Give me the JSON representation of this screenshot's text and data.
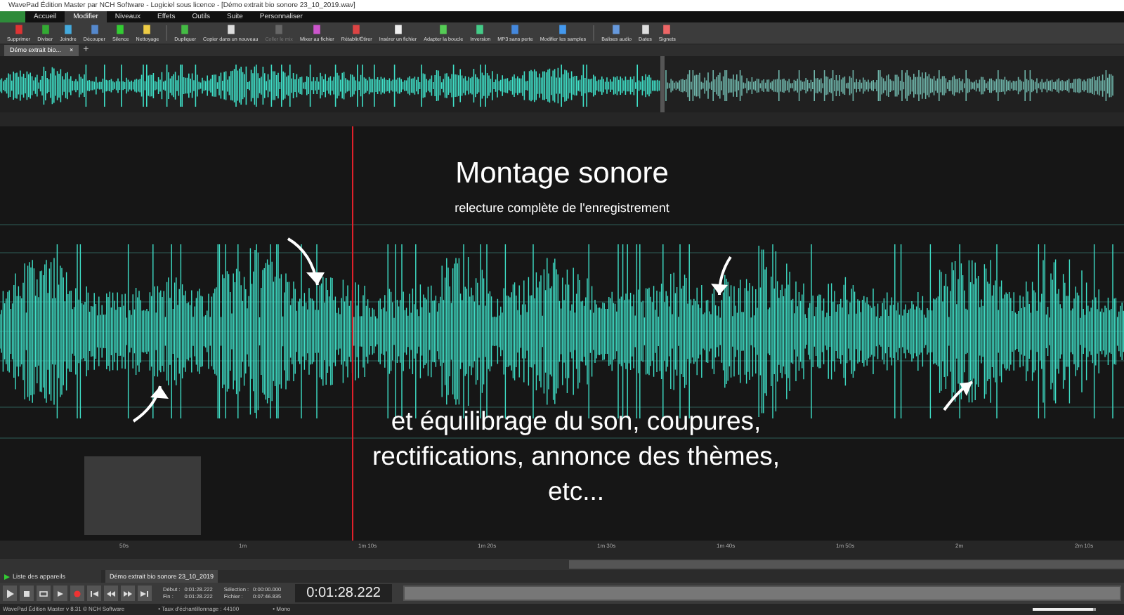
{
  "window": {
    "title": "WavePad Édition Master par NCH Software - Logiciel sous licence - [Démo extrait bio sonore 23_10_2019.wav]"
  },
  "menu_tabs": [
    {
      "label": "Accueil",
      "selected": false
    },
    {
      "label": "Modifier",
      "selected": true
    },
    {
      "label": "Niveaux",
      "selected": false
    },
    {
      "label": "Effets",
      "selected": false
    },
    {
      "label": "Outils",
      "selected": false
    },
    {
      "label": "Suite",
      "selected": false
    },
    {
      "label": "Personnaliser",
      "selected": false
    }
  ],
  "toolbar": [
    {
      "label": "Supprimer",
      "disabled": false
    },
    {
      "label": "Diviser",
      "disabled": false
    },
    {
      "label": "Joindre",
      "disabled": false
    },
    {
      "label": "Découper",
      "disabled": false
    },
    {
      "label": "Silence",
      "disabled": false
    },
    {
      "label": "Nettoyage",
      "disabled": false
    },
    {
      "label": "Dupliquer",
      "disabled": false
    },
    {
      "label": "Copier dans un nouveau",
      "disabled": false
    },
    {
      "label": "Coller le mix",
      "disabled": true
    },
    {
      "label": "Mixer au fichier",
      "disabled": false
    },
    {
      "label": "Rétablir/Étirer",
      "disabled": false
    },
    {
      "label": "Insérer un fichier",
      "disabled": false
    },
    {
      "label": "Adapter la boucle",
      "disabled": false
    },
    {
      "label": "Inversion",
      "disabled": false
    },
    {
      "label": "MP3 sans perte",
      "disabled": false
    },
    {
      "label": "Modifier les samples",
      "disabled": false
    },
    {
      "label": "Balises audio",
      "disabled": false
    },
    {
      "label": "Dates",
      "disabled": false
    },
    {
      "label": "Signets",
      "disabled": false
    }
  ],
  "document_tabs": [
    {
      "label": "Démo extrait bio...",
      "selected": true,
      "close": "×"
    }
  ],
  "new_tab": "+",
  "overlay_text": {
    "title": "Montage sonore",
    "subtitle": "relecture complète de l'enregistrement",
    "body": "et équilibrage du son, coupures, rectifications, annonce des thèmes, etc..."
  },
  "ruler": [
    "50s",
    "1m",
    "1m 10s",
    "1m 20s",
    "1m 30s",
    "1m 40s",
    "1m 50s",
    "2m",
    "2m 10s"
  ],
  "bottom_panel": {
    "device_list": "Liste des appareils",
    "file_tab": "Démo extrait bio sonore 23_10_2019"
  },
  "transport": {
    "start_label": "Début :",
    "start": "0:01:28.222",
    "end_label": "Fin :",
    "end": "0:01:28.222",
    "selection_label": "Sélection :",
    "selection": "0:00:00.000",
    "file_label": "Fichier :",
    "file": "0:07:46.835",
    "position": "0:01:28.222"
  },
  "volume": {
    "level": 0.95
  },
  "status_bar": [
    "WavePad Édition Master v 8.31 © NCH Software",
    "• Taux d'échantillonnage : 44100",
    "• Mono"
  ]
}
